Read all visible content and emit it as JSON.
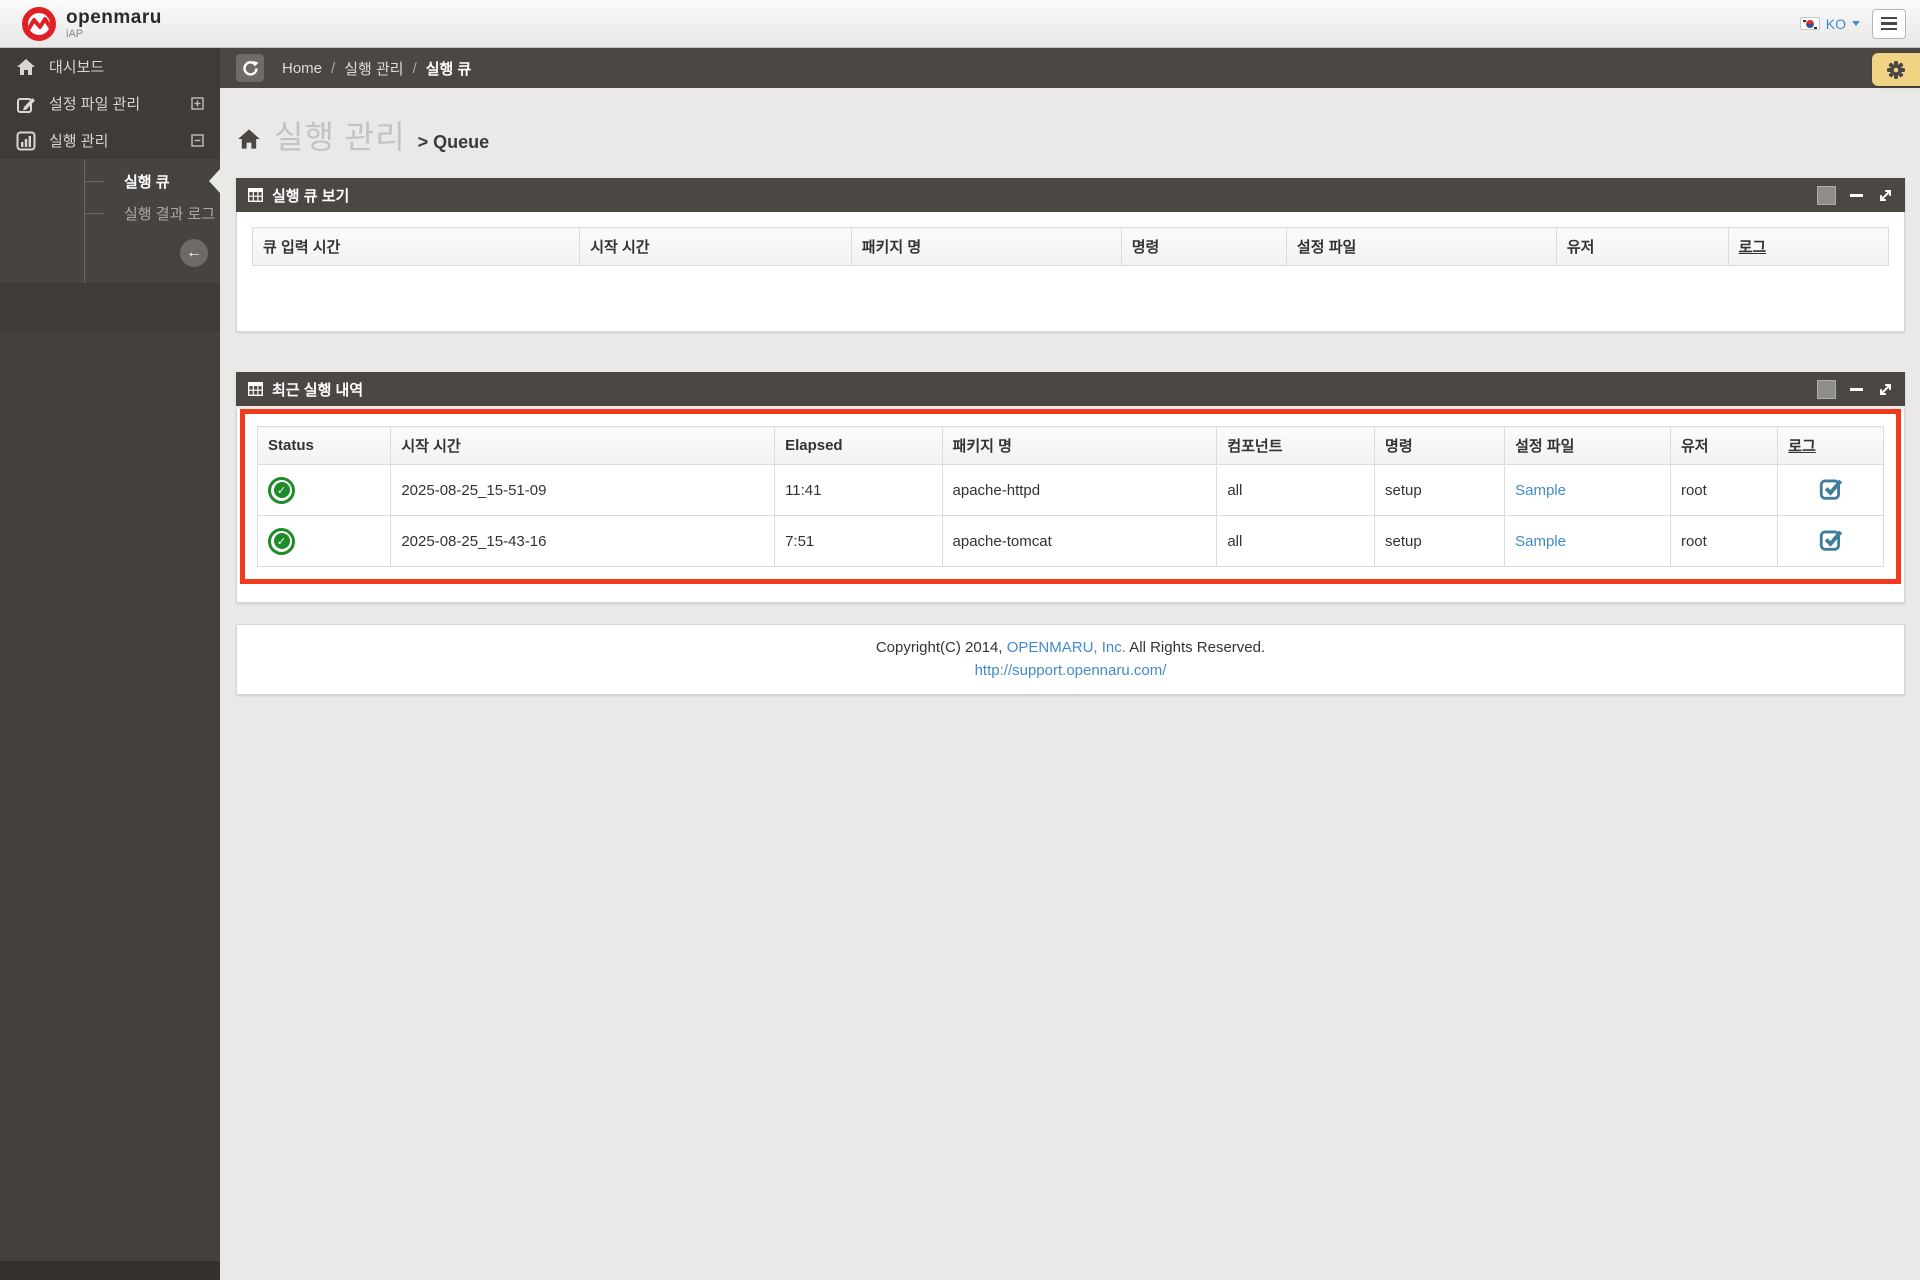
{
  "brand": {
    "name": "openmaru",
    "sub": "iAP"
  },
  "topbar": {
    "language": "KO"
  },
  "breadcrumb": {
    "separator": "/",
    "items": [
      "Home",
      "실행 관리",
      "실행 큐"
    ]
  },
  "page": {
    "title": "실행 관리",
    "subtitle": "> Queue"
  },
  "sidebar": {
    "items": [
      {
        "label": "대시보드"
      },
      {
        "label": "설정 파일 관리"
      },
      {
        "label": "실행 관리"
      }
    ],
    "subitems": [
      {
        "label": "실행 큐"
      },
      {
        "label": "실행 결과 로그"
      }
    ]
  },
  "queue_panel": {
    "title": "실행 큐 보기",
    "columns": [
      "큐 입력 시간",
      "시작 시간",
      "패키지 명",
      "명령",
      "설정 파일",
      "유저",
      "로그"
    ]
  },
  "recent_panel": {
    "title": "최근 실행 내역",
    "columns": [
      "Status",
      "시작 시간",
      "Elapsed",
      "패키지 명",
      "컴포넌트",
      "명령",
      "설정 파일",
      "유저",
      "로그"
    ],
    "rows": [
      {
        "status": "success",
        "start_time": "2025-08-25_15-51-09",
        "elapsed": "11:41",
        "package": "apache-httpd",
        "component": "all",
        "command": "setup",
        "config_file": "Sample",
        "user": "root"
      },
      {
        "status": "success",
        "start_time": "2025-08-25_15-43-16",
        "elapsed": "7:51",
        "package": "apache-tomcat",
        "component": "all",
        "command": "setup",
        "config_file": "Sample",
        "user": "root"
      }
    ]
  },
  "footer": {
    "line1_prefix": "Copyright(C) 2014, ",
    "line1_link": "OPENMARU, Inc.",
    "line1_suffix": " All Rights Reserved.",
    "line2_link": "http://support.opennaru.com/"
  },
  "colors": {
    "accent_dark": "#4b4743",
    "annotation_red": "#f0391d",
    "success_green": "#1f8b29",
    "log_icon_teal": "#3e7e9c",
    "link_blue": "#428bca",
    "gear_tab_yellow": "#f0d483"
  }
}
